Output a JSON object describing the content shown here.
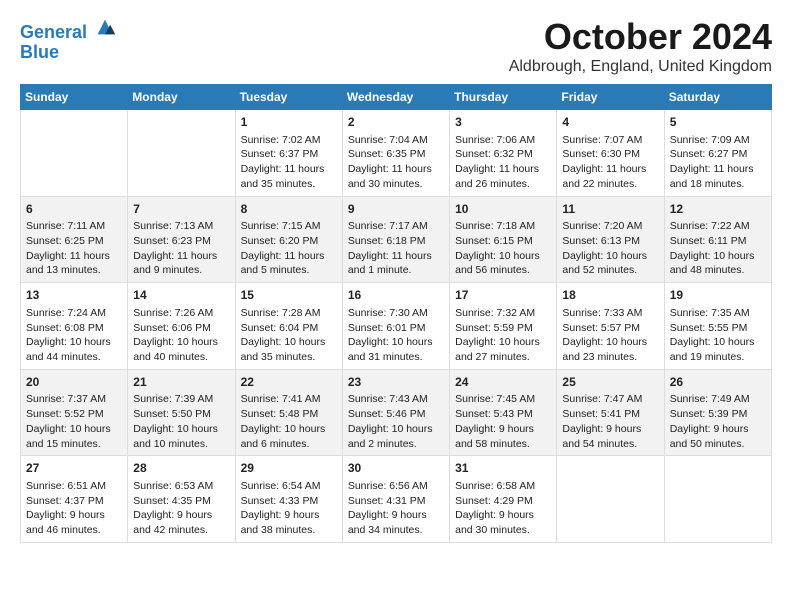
{
  "header": {
    "logo_line1": "General",
    "logo_line2": "Blue",
    "month": "October 2024",
    "location": "Aldbrough, England, United Kingdom"
  },
  "days_of_week": [
    "Sunday",
    "Monday",
    "Tuesday",
    "Wednesday",
    "Thursday",
    "Friday",
    "Saturday"
  ],
  "weeks": [
    [
      {
        "day": "",
        "content": ""
      },
      {
        "day": "",
        "content": ""
      },
      {
        "day": "1",
        "content": "Sunrise: 7:02 AM\nSunset: 6:37 PM\nDaylight: 11 hours\nand 35 minutes."
      },
      {
        "day": "2",
        "content": "Sunrise: 7:04 AM\nSunset: 6:35 PM\nDaylight: 11 hours\nand 30 minutes."
      },
      {
        "day": "3",
        "content": "Sunrise: 7:06 AM\nSunset: 6:32 PM\nDaylight: 11 hours\nand 26 minutes."
      },
      {
        "day": "4",
        "content": "Sunrise: 7:07 AM\nSunset: 6:30 PM\nDaylight: 11 hours\nand 22 minutes."
      },
      {
        "day": "5",
        "content": "Sunrise: 7:09 AM\nSunset: 6:27 PM\nDaylight: 11 hours\nand 18 minutes."
      }
    ],
    [
      {
        "day": "6",
        "content": "Sunrise: 7:11 AM\nSunset: 6:25 PM\nDaylight: 11 hours\nand 13 minutes."
      },
      {
        "day": "7",
        "content": "Sunrise: 7:13 AM\nSunset: 6:23 PM\nDaylight: 11 hours\nand 9 minutes."
      },
      {
        "day": "8",
        "content": "Sunrise: 7:15 AM\nSunset: 6:20 PM\nDaylight: 11 hours\nand 5 minutes."
      },
      {
        "day": "9",
        "content": "Sunrise: 7:17 AM\nSunset: 6:18 PM\nDaylight: 11 hours\nand 1 minute."
      },
      {
        "day": "10",
        "content": "Sunrise: 7:18 AM\nSunset: 6:15 PM\nDaylight: 10 hours\nand 56 minutes."
      },
      {
        "day": "11",
        "content": "Sunrise: 7:20 AM\nSunset: 6:13 PM\nDaylight: 10 hours\nand 52 minutes."
      },
      {
        "day": "12",
        "content": "Sunrise: 7:22 AM\nSunset: 6:11 PM\nDaylight: 10 hours\nand 48 minutes."
      }
    ],
    [
      {
        "day": "13",
        "content": "Sunrise: 7:24 AM\nSunset: 6:08 PM\nDaylight: 10 hours\nand 44 minutes."
      },
      {
        "day": "14",
        "content": "Sunrise: 7:26 AM\nSunset: 6:06 PM\nDaylight: 10 hours\nand 40 minutes."
      },
      {
        "day": "15",
        "content": "Sunrise: 7:28 AM\nSunset: 6:04 PM\nDaylight: 10 hours\nand 35 minutes."
      },
      {
        "day": "16",
        "content": "Sunrise: 7:30 AM\nSunset: 6:01 PM\nDaylight: 10 hours\nand 31 minutes."
      },
      {
        "day": "17",
        "content": "Sunrise: 7:32 AM\nSunset: 5:59 PM\nDaylight: 10 hours\nand 27 minutes."
      },
      {
        "day": "18",
        "content": "Sunrise: 7:33 AM\nSunset: 5:57 PM\nDaylight: 10 hours\nand 23 minutes."
      },
      {
        "day": "19",
        "content": "Sunrise: 7:35 AM\nSunset: 5:55 PM\nDaylight: 10 hours\nand 19 minutes."
      }
    ],
    [
      {
        "day": "20",
        "content": "Sunrise: 7:37 AM\nSunset: 5:52 PM\nDaylight: 10 hours\nand 15 minutes."
      },
      {
        "day": "21",
        "content": "Sunrise: 7:39 AM\nSunset: 5:50 PM\nDaylight: 10 hours\nand 10 minutes."
      },
      {
        "day": "22",
        "content": "Sunrise: 7:41 AM\nSunset: 5:48 PM\nDaylight: 10 hours\nand 6 minutes."
      },
      {
        "day": "23",
        "content": "Sunrise: 7:43 AM\nSunset: 5:46 PM\nDaylight: 10 hours\nand 2 minutes."
      },
      {
        "day": "24",
        "content": "Sunrise: 7:45 AM\nSunset: 5:43 PM\nDaylight: 9 hours\nand 58 minutes."
      },
      {
        "day": "25",
        "content": "Sunrise: 7:47 AM\nSunset: 5:41 PM\nDaylight: 9 hours\nand 54 minutes."
      },
      {
        "day": "26",
        "content": "Sunrise: 7:49 AM\nSunset: 5:39 PM\nDaylight: 9 hours\nand 50 minutes."
      }
    ],
    [
      {
        "day": "27",
        "content": "Sunrise: 6:51 AM\nSunset: 4:37 PM\nDaylight: 9 hours\nand 46 minutes."
      },
      {
        "day": "28",
        "content": "Sunrise: 6:53 AM\nSunset: 4:35 PM\nDaylight: 9 hours\nand 42 minutes."
      },
      {
        "day": "29",
        "content": "Sunrise: 6:54 AM\nSunset: 4:33 PM\nDaylight: 9 hours\nand 38 minutes."
      },
      {
        "day": "30",
        "content": "Sunrise: 6:56 AM\nSunset: 4:31 PM\nDaylight: 9 hours\nand 34 minutes."
      },
      {
        "day": "31",
        "content": "Sunrise: 6:58 AM\nSunset: 4:29 PM\nDaylight: 9 hours\nand 30 minutes."
      },
      {
        "day": "",
        "content": ""
      },
      {
        "day": "",
        "content": ""
      }
    ]
  ]
}
